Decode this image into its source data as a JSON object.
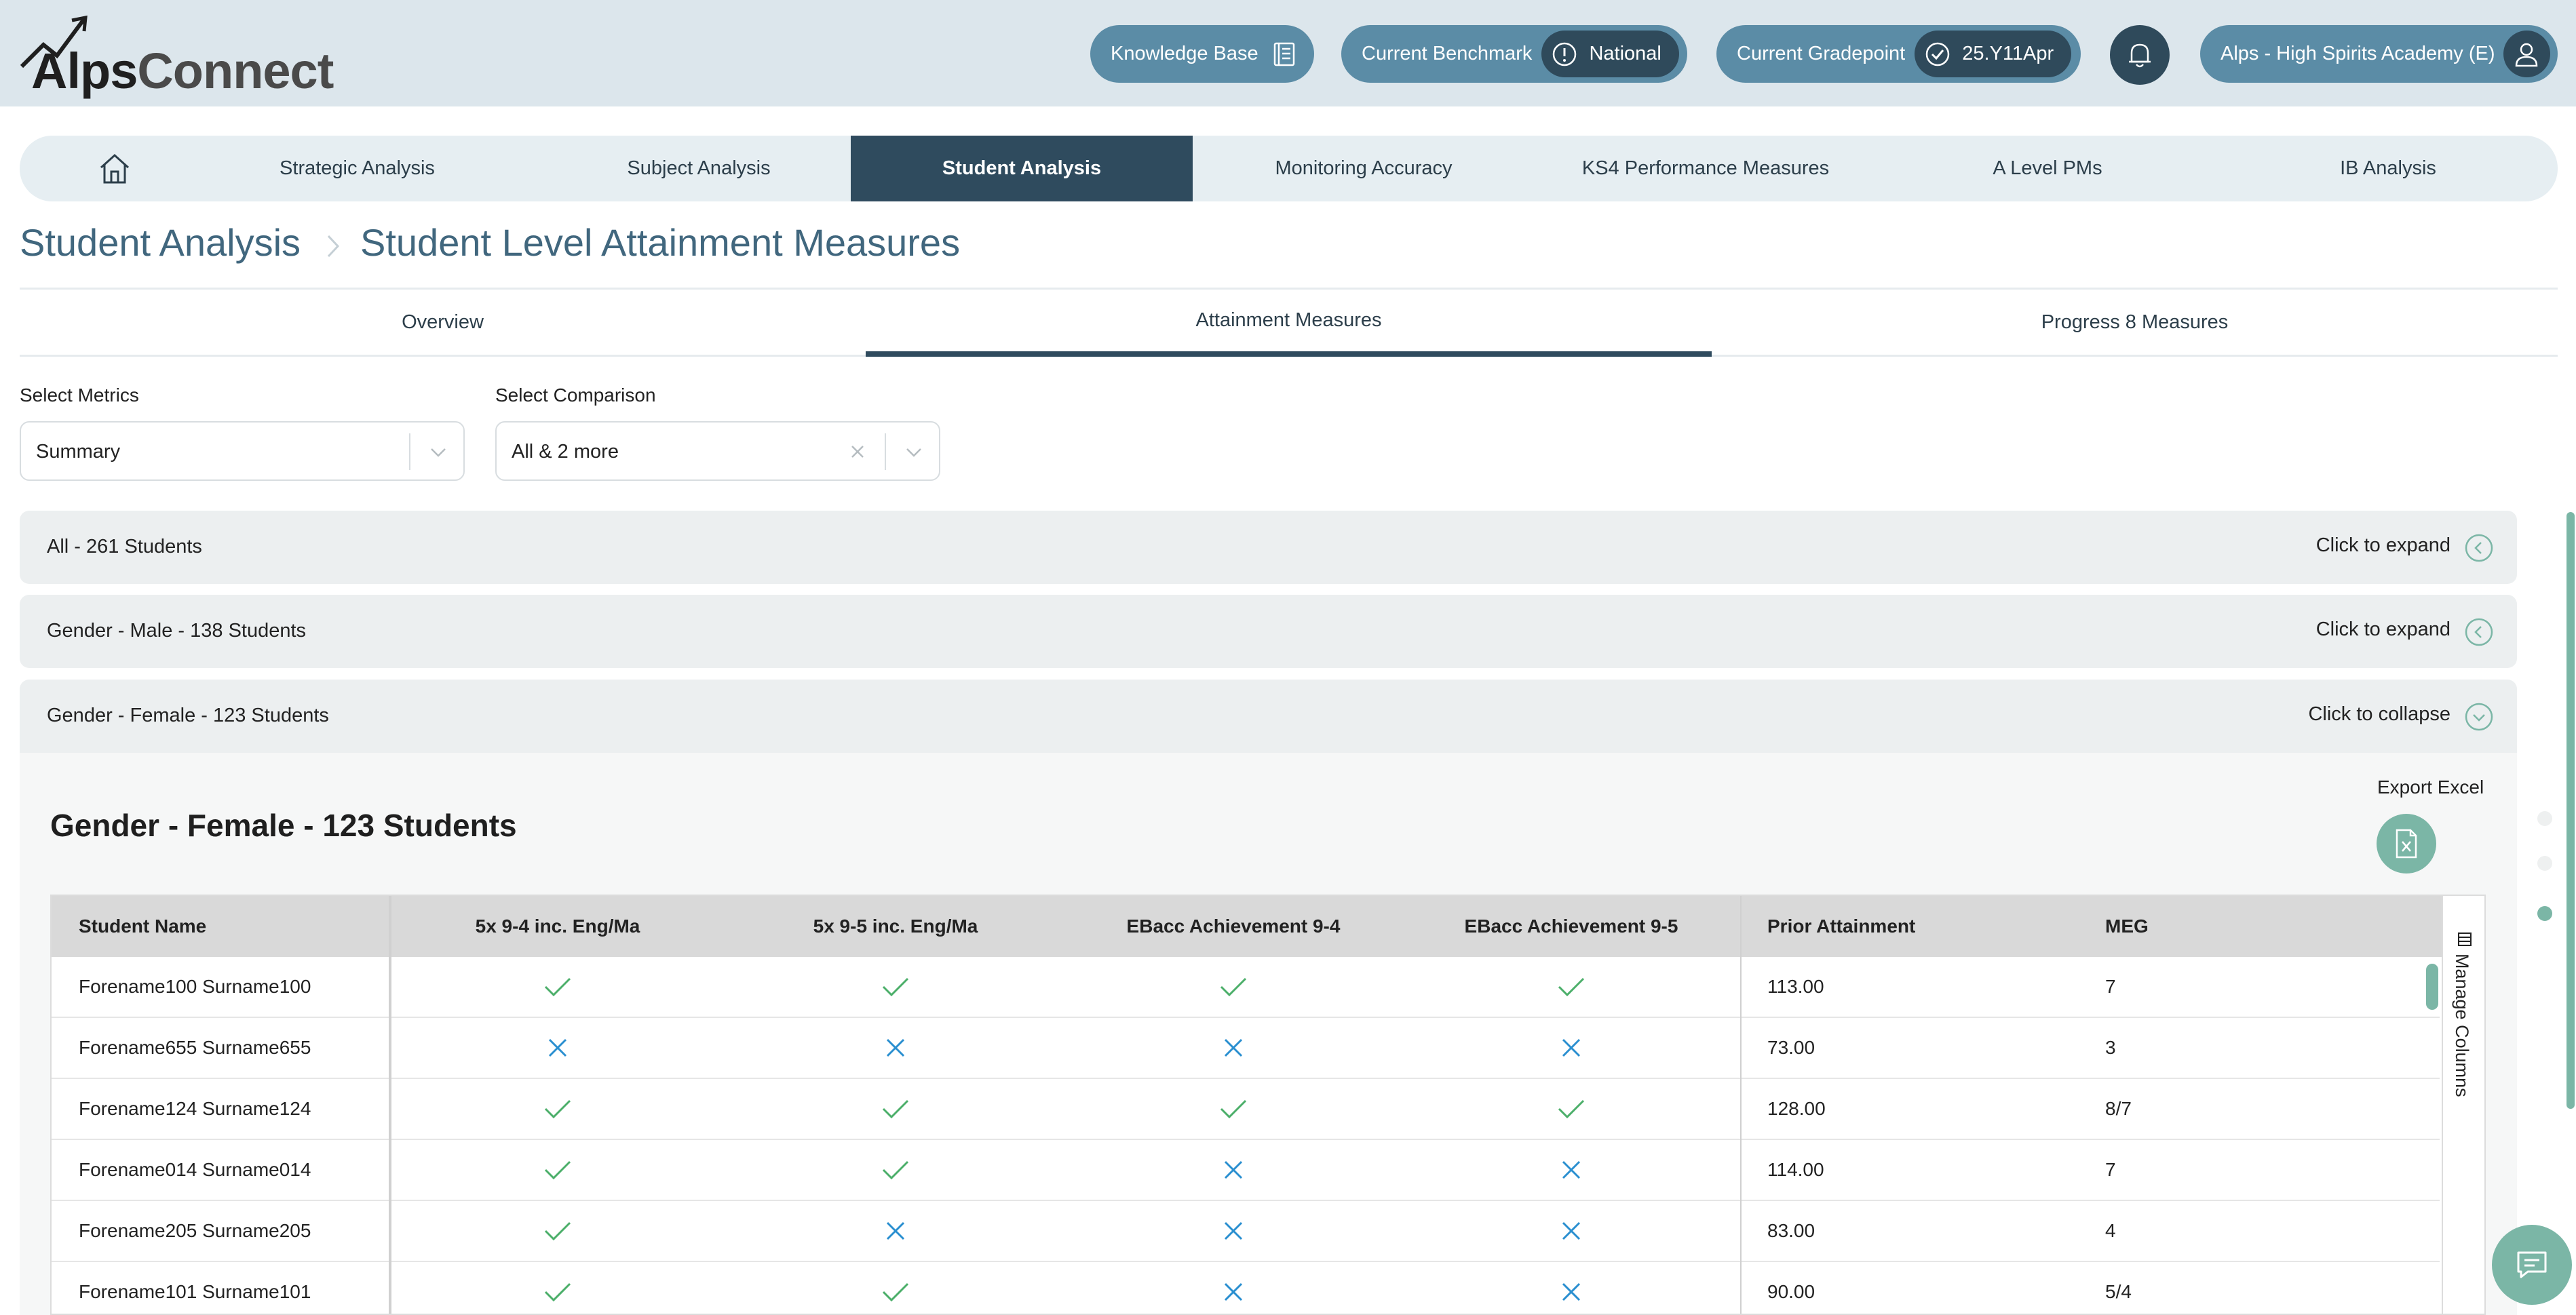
{
  "app": {
    "brand_part1": "Alps",
    "brand_part2": "Connect",
    "accent_color": "#7bb6a6",
    "dark_color": "#2f4b5e"
  },
  "header": {
    "knowledge_base": "Knowledge Base",
    "benchmark_label": "Current Benchmark",
    "benchmark_value": "National",
    "gradepoint_label": "Current Gradepoint",
    "gradepoint_value": "25.Y11Apr",
    "school": "Alps - High Spirits Academy (E)"
  },
  "nav": {
    "home_icon": "home-icon",
    "items": [
      {
        "label": "Strategic Analysis"
      },
      {
        "label": "Subject Analysis"
      },
      {
        "label": "Student Analysis",
        "active": true
      },
      {
        "label": "Monitoring Accuracy"
      },
      {
        "label": "KS4 Performance Measures"
      },
      {
        "label": "A Level PMs"
      },
      {
        "label": "IB Analysis"
      }
    ]
  },
  "breadcrumb": {
    "root": "Student Analysis",
    "current": "Student Level Attainment Measures"
  },
  "subtabs": [
    {
      "label": "Overview"
    },
    {
      "label": "Attainment Measures",
      "active": true
    },
    {
      "label": "Progress 8 Measures"
    }
  ],
  "filters": {
    "metrics_label": "Select Metrics",
    "metrics_value": "Summary",
    "comparison_label": "Select Comparison",
    "comparison_value": "All & 2 more"
  },
  "groups": [
    {
      "title": "All - 261 Students",
      "action": "Click to expand",
      "expanded": false
    },
    {
      "title": "Gender - Male - 138 Students",
      "action": "Click to expand",
      "expanded": false
    },
    {
      "title": "Gender - Female - 123 Students",
      "action": "Click to collapse",
      "expanded": true
    }
  ],
  "panel": {
    "title": "Gender - Female - 123 Students",
    "export_label": "Export Excel",
    "manage_columns": "Manage Columns"
  },
  "table": {
    "headers": [
      "Student Name",
      "5x 9-4 inc. Eng/Ma",
      "5x 9-5 inc. Eng/Ma",
      "EBacc Achievement 9-4",
      "EBacc Achievement 9-5",
      "Prior Attainment",
      "MEG"
    ],
    "rows": [
      {
        "name": "Forename100 Surname100",
        "m1": true,
        "m2": true,
        "m3": true,
        "m4": true,
        "prior": "113.00",
        "meg": "7"
      },
      {
        "name": "Forename655 Surname655",
        "m1": false,
        "m2": false,
        "m3": false,
        "m4": false,
        "prior": "73.00",
        "meg": "3"
      },
      {
        "name": "Forename124 Surname124",
        "m1": true,
        "m2": true,
        "m3": true,
        "m4": true,
        "prior": "128.00",
        "meg": "8/7"
      },
      {
        "name": "Forename014 Surname014",
        "m1": true,
        "m2": true,
        "m3": false,
        "m4": false,
        "prior": "114.00",
        "meg": "7"
      },
      {
        "name": "Forename205 Surname205",
        "m1": true,
        "m2": false,
        "m3": false,
        "m4": false,
        "prior": "83.00",
        "meg": "4"
      },
      {
        "name": "Forename101 Surname101",
        "m1": true,
        "m2": true,
        "m3": false,
        "m4": false,
        "prior": "90.00",
        "meg": "5/4"
      }
    ],
    "tick_color": "#4caf6a",
    "cross_color": "#2a8fd0"
  }
}
